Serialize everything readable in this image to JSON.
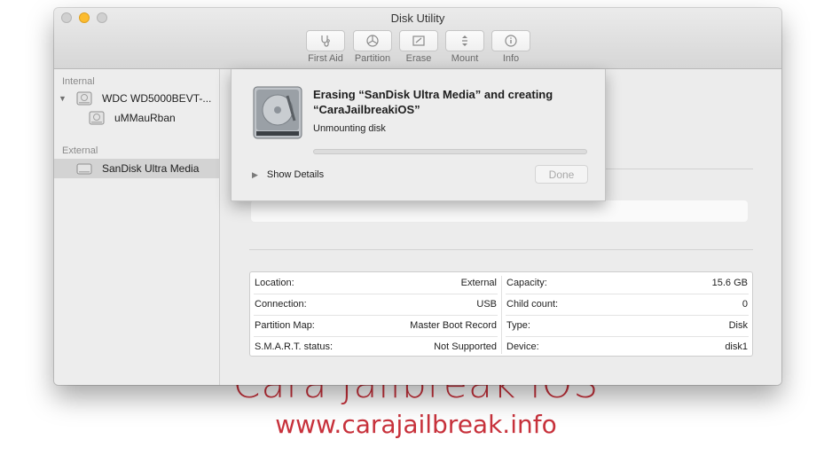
{
  "watermark": {
    "title": "Cara Jailbreak iOS",
    "url": "www.carajailbreak.info"
  },
  "window": {
    "title": "Disk Utility"
  },
  "toolbar": {
    "buttons": [
      {
        "label": "First Aid",
        "icon": "stethoscope-icon"
      },
      {
        "label": "Partition",
        "icon": "pie-partition-icon"
      },
      {
        "label": "Erase",
        "icon": "erase-icon"
      },
      {
        "label": "Mount",
        "icon": "mount-icon"
      },
      {
        "label": "Info",
        "icon": "info-icon"
      }
    ]
  },
  "sidebar": {
    "internal_label": "Internal",
    "external_label": "External",
    "items": [
      {
        "label": "WDC WD5000BEVT-...",
        "icon": "hard-disk-icon"
      },
      {
        "label": "uMMauRban",
        "icon": "volume-icon"
      },
      {
        "label": "SanDisk Ultra Media",
        "icon": "external-disk-icon"
      }
    ]
  },
  "sheet": {
    "title": "Erasing “SanDisk Ultra Media” and creating “CaraJailbreakiOS”",
    "status": "Unmounting disk",
    "progress": 0,
    "show_details": "Show Details",
    "done": "Done"
  },
  "info": {
    "left": [
      {
        "label": "Location:",
        "value": "External"
      },
      {
        "label": "Connection:",
        "value": "USB"
      },
      {
        "label": "Partition Map:",
        "value": "Master Boot Record"
      },
      {
        "label": "S.M.A.R.T. status:",
        "value": "Not Supported"
      }
    ],
    "right": [
      {
        "label": "Capacity:",
        "value": "15.6 GB"
      },
      {
        "label": "Child count:",
        "value": "0"
      },
      {
        "label": "Type:",
        "value": "Disk"
      },
      {
        "label": "Device:",
        "value": "disk1"
      }
    ]
  },
  "colors": {
    "accent": "#2f84ff",
    "watermark": "#c8323c",
    "minimize": "#fcbc2f"
  }
}
